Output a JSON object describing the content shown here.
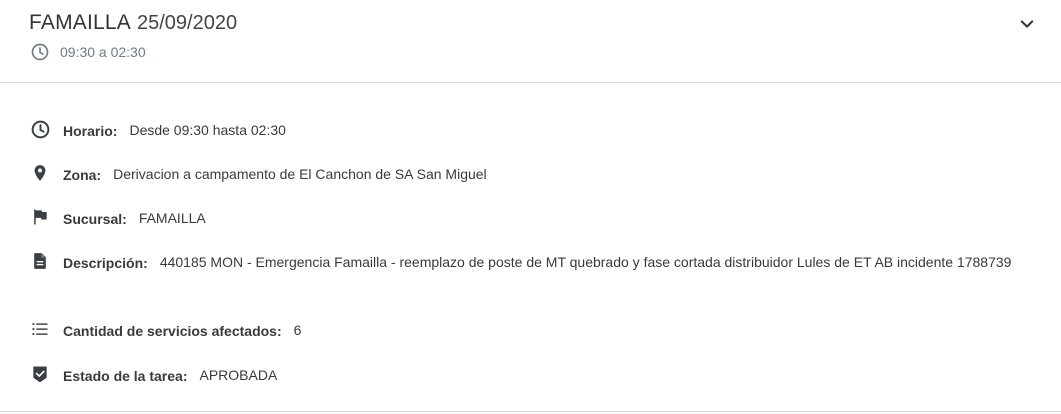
{
  "header": {
    "name": "FAMAILLA",
    "date": "25/09/2020",
    "time_range": "09:30 a 02:30"
  },
  "details": {
    "horario": {
      "icon": "clock-icon",
      "label": "Horario:",
      "value": "Desde 09:30 hasta 02:30"
    },
    "zona": {
      "icon": "location-pin-icon",
      "label": "Zona:",
      "value": "Derivacion a campamento de El Canchon de SA San Miguel"
    },
    "sucursal": {
      "icon": "flag-icon",
      "label": "Sucursal:",
      "value": "FAMAILLA"
    },
    "descripcion": {
      "icon": "document-icon",
      "label": "Descripción:",
      "value": "440185 MON - Emergencia Famailla - reemplazo de poste de MT quebrado y fase cortada distribuidor Lules de ET AB incidente 1788739"
    },
    "servicios": {
      "icon": "list-icon",
      "label": "Cantidad de servicios afectados:",
      "value": "6"
    },
    "estado": {
      "icon": "check-shield-icon",
      "label": "Estado de la tarea:",
      "value": "APROBADA"
    }
  },
  "colors": {
    "icon": "#3a3f44",
    "muted": "#6f7b86",
    "divider": "#dcdcdc"
  }
}
